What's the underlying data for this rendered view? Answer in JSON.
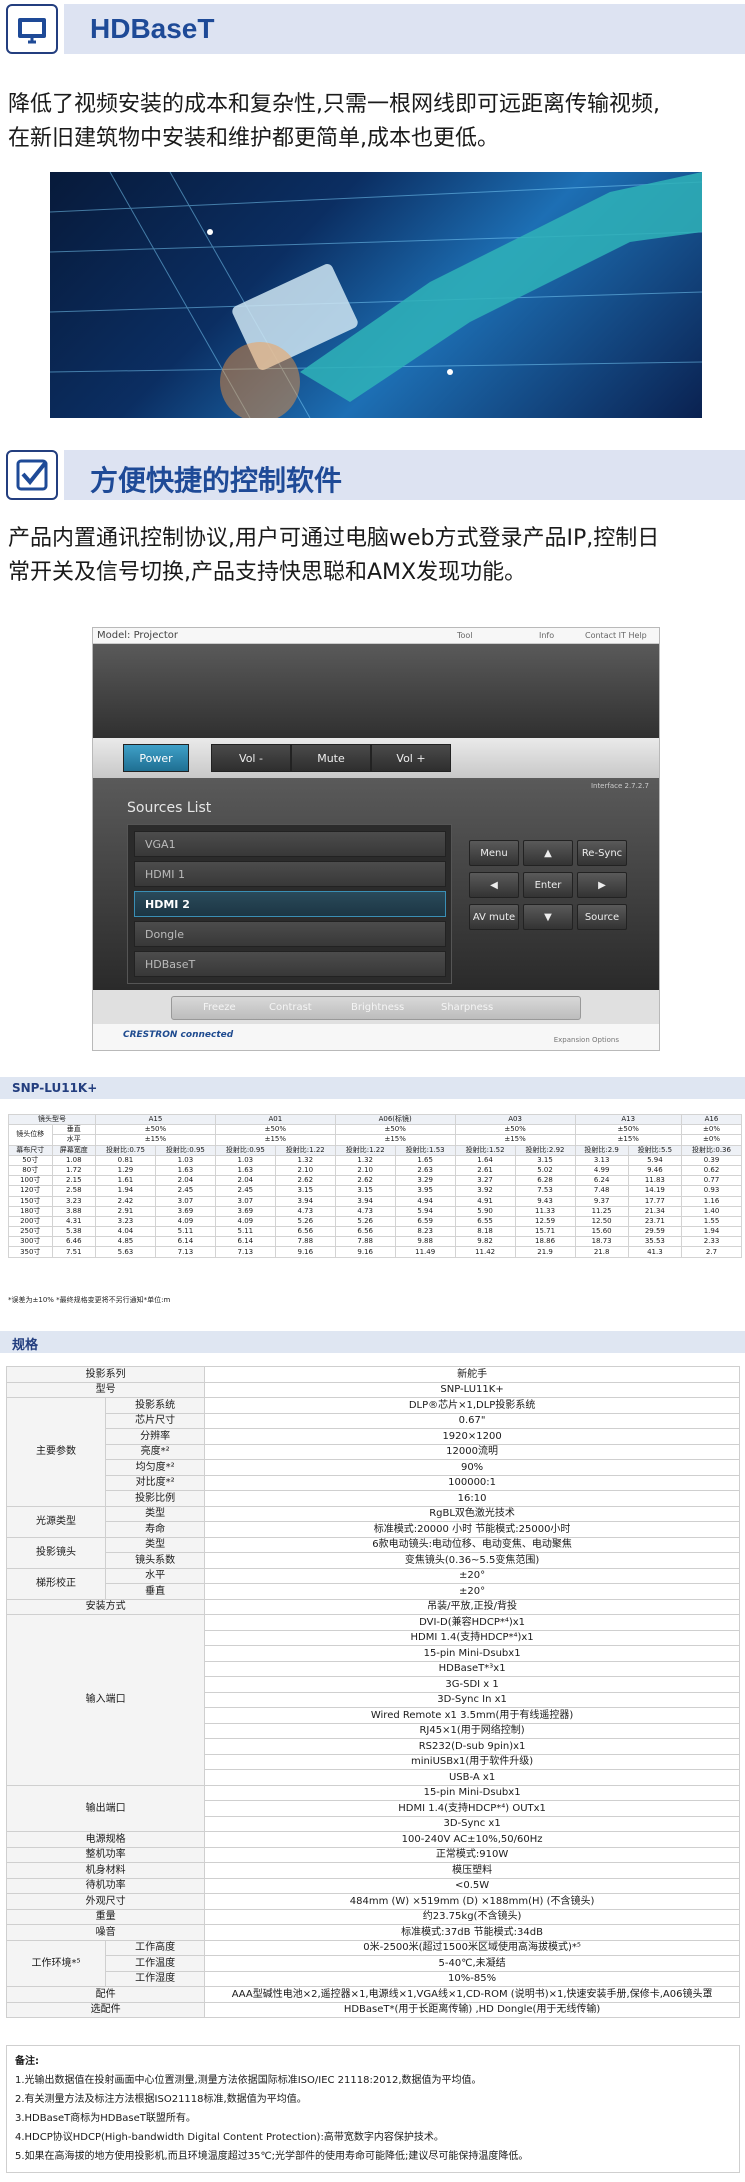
{
  "section1": {
    "title": "HDBaseT",
    "desc_line1": "降低了视频安装的成本和复杂性,只需一根网线即可远距离传输视频,",
    "desc_line2": "在新旧建筑物中安装和维护都更简单,成本也更低。"
  },
  "section2": {
    "title": "方便快捷的控制软件",
    "desc_line1": "产品内置通讯控制协议,用户可通过电脑web方式登录产品IP,控制日",
    "desc_line2": "常开关及信号切换,产品支持快思聪和AMX发现功能。"
  },
  "software": {
    "model_label": "Model: Projector",
    "links": [
      "Tool",
      "Info",
      "Contact IT Help"
    ],
    "controls": [
      "Power",
      "Vol -",
      "Mute",
      "Vol +"
    ],
    "version": "Interface 2.7.2.7",
    "sources_label": "Sources List",
    "sources": [
      "VGA1",
      "HDMI 1",
      "HDMI 2",
      "Dongle",
      "HDBaseT"
    ],
    "active_source": "HDMI 2",
    "keys": {
      "menu": "Menu",
      "up": "▲",
      "resync": "Re-Sync",
      "left": "◀",
      "enter": "Enter",
      "right": "▶",
      "avmute": "AV mute",
      "down": "▼",
      "source": "Source"
    },
    "slider": [
      "Freeze",
      "Contrast",
      "Brightness",
      "Sharpness"
    ],
    "brand": "CRESTRON connected",
    "footer_right": "Expansion Options"
  },
  "model_name": "SNP-LU11K+",
  "throw_table": {
    "lens_label": "镜头型号",
    "shift_label": "镜头位移",
    "vertical_label": "垂直",
    "horizontal_label": "水平",
    "size_label": "幕布尺寸",
    "width_label": "屏幕宽度",
    "lenses": [
      "A15",
      "A01",
      "A06(标镜)",
      "A03",
      "A13",
      "A16"
    ],
    "vertical": [
      "±50%",
      "±50%",
      "±50%",
      "±50%",
      "±50%",
      "±0%"
    ],
    "horizontal": [
      "±15%",
      "±15%",
      "±15%",
      "±15%",
      "±15%",
      "±0%"
    ],
    "ratios": [
      "投射比:0.75",
      "投射比:0.95",
      "投射比:0.95",
      "投射比:1.22",
      "投射比:1.22",
      "投射比:1.53",
      "投射比:1.52",
      "投射比:2.92",
      "投射比:2.9",
      "投射比:5.5",
      "投射比:0.36"
    ],
    "rows": [
      [
        "50寸",
        "1.08",
        "0.81",
        "1.03",
        "1.03",
        "1.32",
        "1.32",
        "1.65",
        "1.64",
        "3.15",
        "3.13",
        "5.94",
        "0.39"
      ],
      [
        "80寸",
        "1.72",
        "1.29",
        "1.63",
        "1.63",
        "2.10",
        "2.10",
        "2.63",
        "2.61",
        "5.02",
        "4.99",
        "9.46",
        "0.62"
      ],
      [
        "100寸",
        "2.15",
        "1.61",
        "2.04",
        "2.04",
        "2.62",
        "2.62",
        "3.29",
        "3.27",
        "6.28",
        "6.24",
        "11.83",
        "0.77"
      ],
      [
        "120寸",
        "2.58",
        "1.94",
        "2.45",
        "2.45",
        "3.15",
        "3.15",
        "3.95",
        "3.92",
        "7.53",
        "7.48",
        "14.19",
        "0.93"
      ],
      [
        "150寸",
        "3.23",
        "2.42",
        "3.07",
        "3.07",
        "3.94",
        "3.94",
        "4.94",
        "4.91",
        "9.43",
        "9.37",
        "17.77",
        "1.16"
      ],
      [
        "180寸",
        "3.88",
        "2.91",
        "3.69",
        "3.69",
        "4.73",
        "4.73",
        "5.94",
        "5.90",
        "11.33",
        "11.25",
        "21.34",
        "1.40"
      ],
      [
        "200寸",
        "4.31",
        "3.23",
        "4.09",
        "4.09",
        "5.26",
        "5.26",
        "6.59",
        "6.55",
        "12.59",
        "12.50",
        "23.71",
        "1.55"
      ],
      [
        "250寸",
        "5.38",
        "4.04",
        "5.11",
        "5.11",
        "6.56",
        "6.56",
        "8.23",
        "8.18",
        "15.71",
        "15.60",
        "29.59",
        "1.94"
      ],
      [
        "300寸",
        "6.46",
        "4.85",
        "6.14",
        "6.14",
        "7.88",
        "7.88",
        "9.88",
        "9.82",
        "18.86",
        "18.73",
        "35.53",
        "2.33"
      ],
      [
        "350寸",
        "7.51",
        "5.63",
        "7.13",
        "7.13",
        "9.16",
        "9.16",
        "11.49",
        "11.42",
        "21.9",
        "21.8",
        "41.3",
        "2.7"
      ]
    ],
    "note": "*误差为±10%  *最终规格变更将不另行通知*单位:m"
  },
  "spec_title": "规格",
  "spec": {
    "series_label": "投影系列",
    "series_value": "新舵手",
    "model_label": "型号",
    "model_value": "SNP-LU11K+",
    "main_group": "主要参数",
    "main": [
      [
        "投影系统",
        "DLP®芯片×1,DLP投影系统"
      ],
      [
        "芯片尺寸",
        "0.67\""
      ],
      [
        "分辨率",
        "1920×1200"
      ],
      [
        "亮度*²",
        "12000流明"
      ],
      [
        "均匀度*²",
        "90%"
      ],
      [
        "对比度*²",
        "100000:1"
      ],
      [
        "投影比例",
        "16:10"
      ]
    ],
    "light_group": "光源类型",
    "light": [
      [
        "类型",
        "RgBL双色激光技术"
      ],
      [
        "寿命",
        "标准模式:20000 小时  节能模式:25000小时"
      ]
    ],
    "lens_group": "投影镜头",
    "lens": [
      [
        "类型",
        "6款电动镜头:电动位移、电动变焦、电动聚焦"
      ],
      [
        "镜头系数",
        "变焦镜头(0.36~5.5变焦范围)"
      ]
    ],
    "keystone_group": "梯形校正",
    "keystone": [
      [
        "水平",
        "±20°"
      ],
      [
        "垂直",
        "±20°"
      ]
    ],
    "install_label": "安装方式",
    "install_value": "吊装/平放,正投/背投",
    "input_group": "输入端口",
    "inputs": [
      "DVI-D(兼容HDCP*⁴)x1",
      "HDMI 1.4(支持HDCP*⁴)x1",
      "15-pin Mini-Dsubx1",
      "HDBaseT*³x1",
      "3G-SDI x 1",
      "3D-Sync In x1",
      "Wired Remote x1  3.5mm(用于有线遥控器)",
      "RJ45×1(用于网络控制)",
      "RS232(D-sub 9pin)x1",
      "miniUSBx1(用于软件升级)",
      "USB-A x1"
    ],
    "output_group": "输出端口",
    "outputs": [
      "15-pin Mini-Dsubx1",
      "HDMI 1.4(支持HDCP*⁴) OUTx1",
      "3D-Sync x1"
    ],
    "rows2": [
      [
        "电源规格",
        "100-240V AC±10%,50/60Hz"
      ],
      [
        "整机功率",
        "正常模式:910W"
      ],
      [
        "机身材料",
        "模压塑料"
      ],
      [
        "待机功率",
        "<0.5W"
      ],
      [
        "外观尺寸",
        "484mm (W) ×519mm (D) ×188mm(H) (不含镜头)"
      ],
      [
        "重量",
        "约23.75kg(不含镜头)"
      ],
      [
        "噪音",
        "标准模式:37dB 节能模式:34dB"
      ]
    ],
    "env_group": "工作环境*⁵",
    "env": [
      [
        "工作高度",
        "0米-2500米(超过1500米区域使用高海拔模式)*⁵"
      ],
      [
        "工作温度",
        "5-40℃,未凝结"
      ],
      [
        "工作湿度",
        "10%-85%"
      ]
    ],
    "accessory_label": "配件",
    "accessory_value": "AAA型碱性电池×2,遥控器×1,电源线×1,VGA线×1,CD-ROM (说明书)×1,快速安装手册,保修卡,A06镜头罩",
    "optional_label": "选配件",
    "optional_value": "HDBaseT*(用于长距离传输) ,HD Dongle(用于无线传输)"
  },
  "notes": {
    "title": "备注:",
    "items": [
      "1.光输出数据值在投射画面中心位置测量,测量方法依据国际标准ISO/IEC 21118:2012,数据值为平均值。",
      "2.有关测量方法及标注方法根据ISO21118标准,数据值为平均值。",
      "3.HDBaseT商标为HDBaseT联盟所有。",
      "4.HDCP协议HDCP(High-bandwidth Digital Content Protection):高带宽数字内容保护技术。",
      "5.如果在高海拔的地方使用投影机,而且环境温度超过35℃;光学部件的使用寿命可能降低;建议尽可能保持温度降低。"
    ]
  },
  "colors": {
    "accent": "#1e4a97",
    "band": "#dde3f2",
    "power": "#2f8ab0"
  }
}
